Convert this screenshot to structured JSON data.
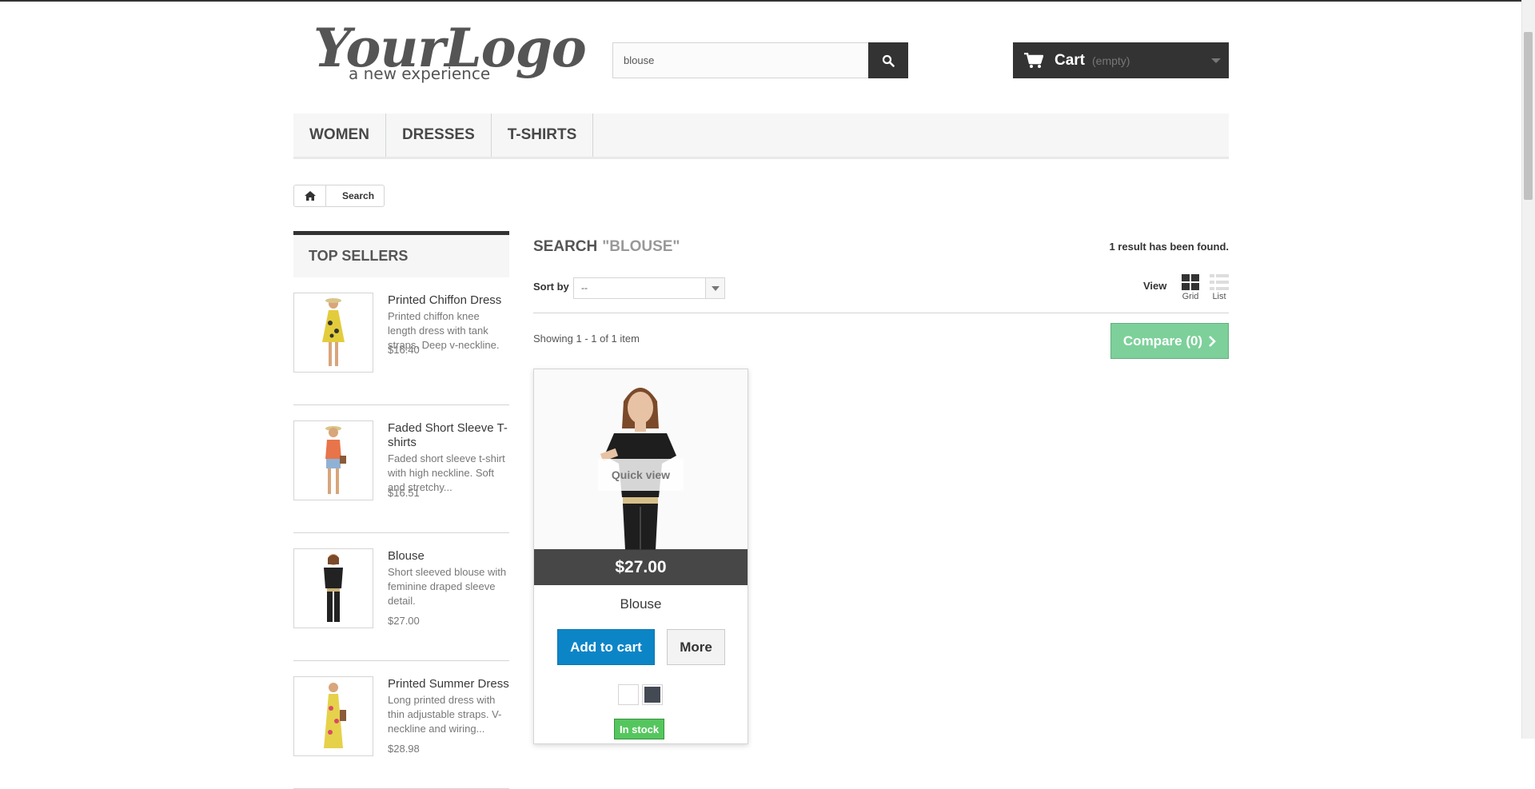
{
  "logo": {
    "main": "YourLogo",
    "sub": "a new experience"
  },
  "search": {
    "value": "blouse",
    "button_icon": "search-icon"
  },
  "cart": {
    "label": "Cart",
    "status": "(empty)"
  },
  "menu": {
    "items": [
      "WOMEN",
      "DRESSES",
      "T-SHIRTS"
    ]
  },
  "breadcrumb": {
    "home_icon": "home-icon",
    "current": "Search"
  },
  "sidebar": {
    "title": "TOP SELLERS",
    "items": [
      {
        "name": "Printed Chiffon Dress",
        "desc": "Printed chiffon knee length dress with tank straps. Deep v-neckline.",
        "price": "$16.40",
        "dress_color": "#e3cc3c"
      },
      {
        "name": "Faded Short Sleeve T-shirts",
        "desc": "Faded short sleeve t-shirt with high neckline. Soft and stretchy...",
        "price": "$16.51",
        "dress_color": "#e8744a"
      },
      {
        "name": "Blouse",
        "desc": "Short sleeved blouse with feminine draped sleeve detail.",
        "price": "$27.00",
        "dress_color": "#222222"
      },
      {
        "name": "Printed Summer Dress",
        "desc": "Long printed dress with thin adjustable straps. V-neckline and wiring...",
        "price": "$28.98",
        "dress_color": "#e6d14a"
      }
    ]
  },
  "main": {
    "title": "SEARCH",
    "query": "\"BLOUSE\"",
    "result_count": "1 result has been found.",
    "sort_label": "Sort by",
    "sort_value": "--",
    "view_label": "View",
    "view_grid": "Grid",
    "view_list": "List",
    "showing": "Showing 1 - 1 of 1 item",
    "compare": "Compare (0)"
  },
  "product": {
    "quick_view": "Quick view",
    "price": "$27.00",
    "name": "Blouse",
    "add_to_cart": "Add to cart",
    "more": "More",
    "colors": [
      "#ffffff",
      "#434a54"
    ],
    "availability": "In stock"
  }
}
